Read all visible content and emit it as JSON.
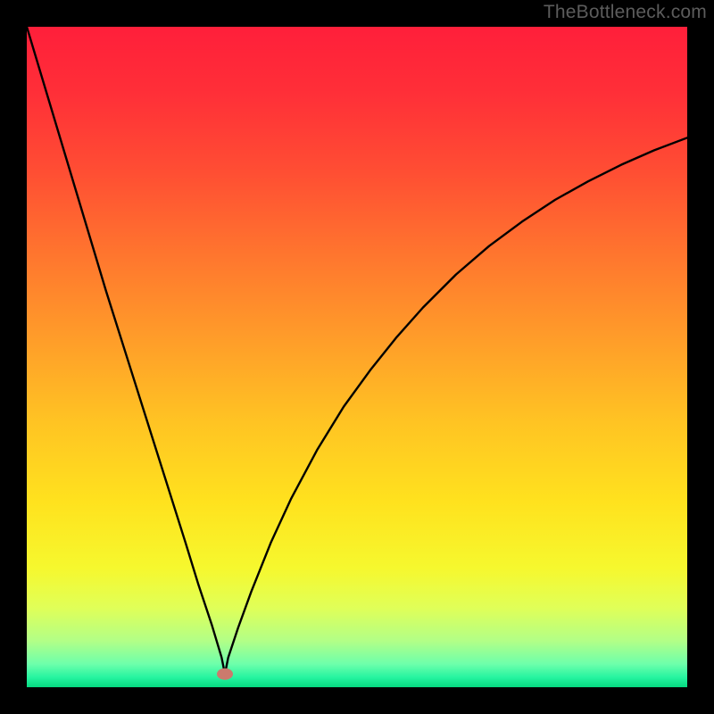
{
  "watermark": "TheBottleneck.com",
  "chart_data": {
    "type": "line",
    "title": "",
    "xlabel": "",
    "ylabel": "",
    "xlim": [
      0,
      100
    ],
    "ylim": [
      0,
      100
    ],
    "minimum_marker": {
      "x": 30,
      "y": 2
    },
    "series": [
      {
        "name": "bottleneck-curve",
        "x": [
          0,
          3,
          6,
          9,
          12,
          15,
          18,
          21,
          24,
          26,
          28,
          29.5,
          30,
          30.5,
          32,
          34,
          37,
          40,
          44,
          48,
          52,
          56,
          60,
          65,
          70,
          75,
          80,
          85,
          90,
          95,
          100
        ],
        "y": [
          100,
          90,
          80,
          70,
          60,
          50.5,
          41,
          31.5,
          22,
          15.5,
          9.5,
          4.5,
          2,
          4.5,
          9,
          14.5,
          22,
          28.5,
          36,
          42.5,
          48,
          53,
          57.5,
          62.5,
          66.8,
          70.5,
          73.8,
          76.6,
          79.1,
          81.3,
          83.2
        ]
      }
    ],
    "background_gradient": {
      "stops": [
        {
          "offset": 0.0,
          "color": "#ff1f3a"
        },
        {
          "offset": 0.1,
          "color": "#ff2f38"
        },
        {
          "offset": 0.22,
          "color": "#ff4e33"
        },
        {
          "offset": 0.35,
          "color": "#ff772e"
        },
        {
          "offset": 0.48,
          "color": "#ff9f29"
        },
        {
          "offset": 0.6,
          "color": "#ffc423"
        },
        {
          "offset": 0.72,
          "color": "#ffe21e"
        },
        {
          "offset": 0.82,
          "color": "#f6f82e"
        },
        {
          "offset": 0.88,
          "color": "#e0ff58"
        },
        {
          "offset": 0.93,
          "color": "#b2ff87"
        },
        {
          "offset": 0.965,
          "color": "#6dffab"
        },
        {
          "offset": 0.985,
          "color": "#26f4a0"
        },
        {
          "offset": 1.0,
          "color": "#05d980"
        }
      ]
    },
    "marker_color": "#cb7a6d",
    "curve_color": "#000000"
  }
}
